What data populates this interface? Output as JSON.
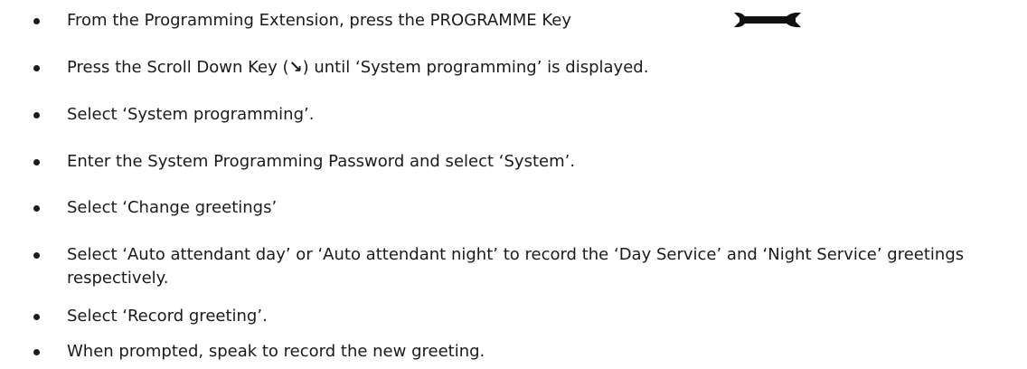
{
  "steps": [
    {
      "text": "From the Programming Extension, press the PROGRAMME Key",
      "icon": "wrench-icon"
    },
    {
      "before": "Press the Scroll Down Key (",
      "glyph": "↘",
      "after": ") until ‘System programming’ is displayed."
    },
    {
      "text": "Select ‘System programming’."
    },
    {
      "text": "Enter the System Programming Password and select ‘System’."
    },
    {
      "text": "Select ‘Change greetings’"
    },
    {
      "text": "Select ‘Auto attendant day’ or ‘Auto attendant night’ to record the ‘Day Service’ and ‘Night Service’ greetings respectively."
    },
    {
      "text": "Select ‘Record greeting’."
    },
    {
      "text": "When prompted, speak to record the new greeting."
    }
  ]
}
